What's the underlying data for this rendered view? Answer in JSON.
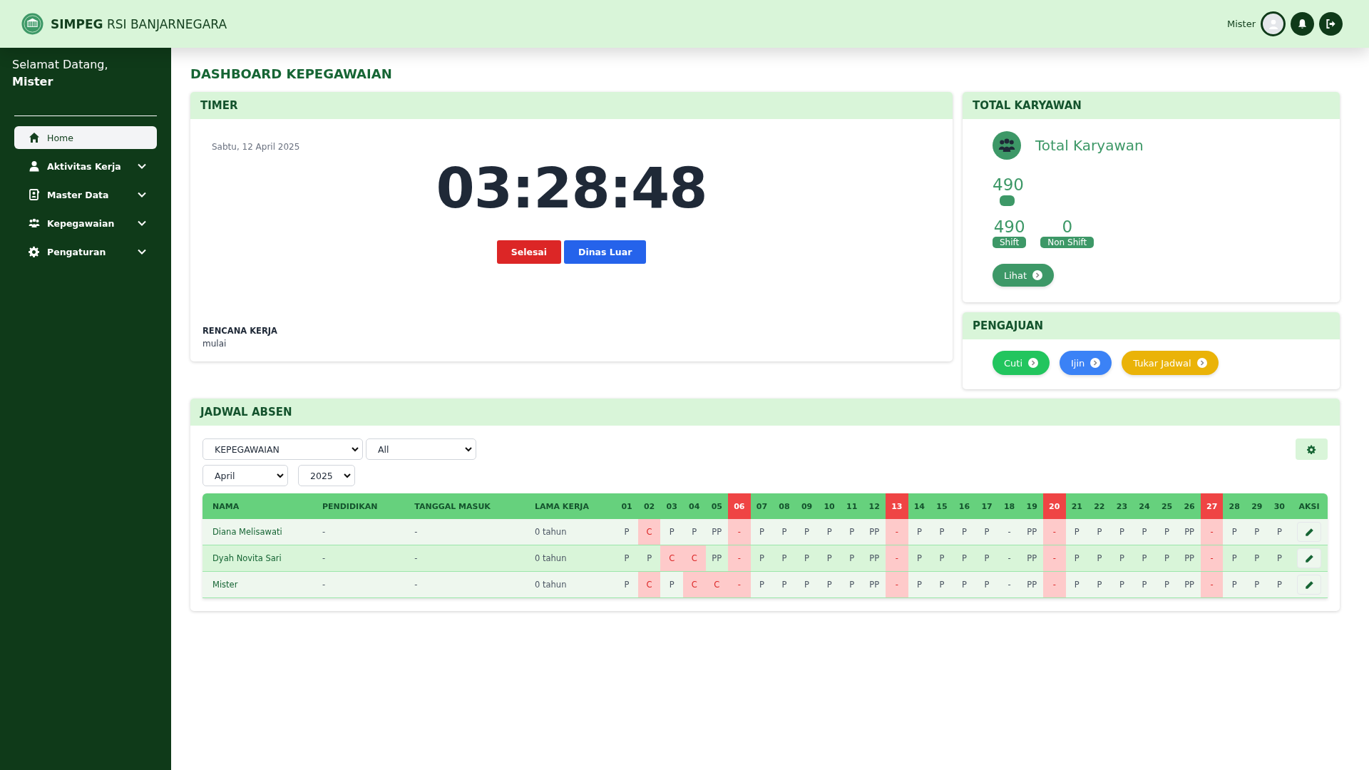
{
  "header": {
    "app_name_bold": "SIMPEG",
    "app_name_rest": "RSI BANJARNEGARA",
    "user_name": "Mister"
  },
  "sidebar": {
    "greeting": "Selamat Datang,",
    "user": "Mister",
    "items": [
      {
        "label": "Home",
        "selected": true,
        "expandable": false
      },
      {
        "label": "Aktivitas Kerja",
        "selected": false,
        "expandable": true
      },
      {
        "label": "Master Data",
        "selected": false,
        "expandable": true
      },
      {
        "label": "Kepegawaian",
        "selected": false,
        "expandable": true
      },
      {
        "label": "Pengaturan",
        "selected": false,
        "expandable": true
      }
    ]
  },
  "page_title": "DASHBOARD KEPEGAWAIAN",
  "timer": {
    "title": "TIMER",
    "date": "Sabtu, 12 April 2025",
    "time": "03:28:48",
    "buttons": [
      {
        "label": "Selesai",
        "color": "#dc2626"
      },
      {
        "label": "Dinas Luar",
        "color": "#2563eb"
      }
    ],
    "plan_label": "RENCANA KERJA",
    "plan_value": "mulai"
  },
  "total_karyawan": {
    "title": "TOTAL KARYAWAN",
    "heading": "Total Karyawan",
    "total": "490",
    "stats": [
      {
        "value": "490",
        "label": "Shift"
      },
      {
        "value": "0",
        "label": "Non Shift"
      }
    ],
    "button": "Lihat"
  },
  "pengajuan": {
    "title": "PENGAJUAN",
    "buttons": [
      {
        "label": "Cuti",
        "color": "#22c55e"
      },
      {
        "label": "Ijin",
        "color": "#3b82f6"
      },
      {
        "label": "Tukar Jadwal",
        "color": "#eab308"
      }
    ]
  },
  "jadwal": {
    "title": "JADWAL ABSEN",
    "filters": [
      "KEPEGAWAIAN",
      "All",
      "April",
      "2025"
    ],
    "columns": [
      "NAMA",
      "PENDIDIKAN",
      "TANGGAL MASUK",
      "LAMA KERJA"
    ],
    "days": [
      {
        "label": "01",
        "holiday": false
      },
      {
        "label": "02",
        "holiday": false
      },
      {
        "label": "03",
        "holiday": false
      },
      {
        "label": "04",
        "holiday": false
      },
      {
        "label": "05",
        "holiday": false
      },
      {
        "label": "06",
        "holiday": true
      },
      {
        "label": "07",
        "holiday": false
      },
      {
        "label": "08",
        "holiday": false
      },
      {
        "label": "09",
        "holiday": false
      },
      {
        "label": "10",
        "holiday": false
      },
      {
        "label": "11",
        "holiday": false
      },
      {
        "label": "12",
        "holiday": false
      },
      {
        "label": "13",
        "holiday": true
      },
      {
        "label": "14",
        "holiday": false
      },
      {
        "label": "15",
        "holiday": false
      },
      {
        "label": "16",
        "holiday": false
      },
      {
        "label": "17",
        "holiday": false
      },
      {
        "label": "18",
        "holiday": false
      },
      {
        "label": "19",
        "holiday": false
      },
      {
        "label": "20",
        "holiday": true
      },
      {
        "label": "21",
        "holiday": false
      },
      {
        "label": "22",
        "holiday": false
      },
      {
        "label": "23",
        "holiday": false
      },
      {
        "label": "24",
        "holiday": false
      },
      {
        "label": "25",
        "holiday": false
      },
      {
        "label": "26",
        "holiday": false
      },
      {
        "label": "27",
        "holiday": true
      },
      {
        "label": "28",
        "holiday": false
      },
      {
        "label": "29",
        "holiday": false
      },
      {
        "label": "30",
        "holiday": false
      }
    ],
    "action_column": "AKSI",
    "rows": [
      {
        "name": "Diana Melisawati",
        "pendidikan": "-",
        "tanggal_masuk": "-",
        "lama_kerja": "0 tahun",
        "cells": [
          {
            "text": "P",
            "kind": "plain"
          },
          {
            "text": "C",
            "kind": "marked"
          },
          {
            "text": "P",
            "kind": "plain"
          },
          {
            "text": "P",
            "kind": "plain"
          },
          {
            "text": "PP",
            "kind": "plain"
          },
          {
            "text": "-",
            "kind": "marked"
          },
          {
            "text": "P",
            "kind": "plain"
          },
          {
            "text": "P",
            "kind": "plain"
          },
          {
            "text": "P",
            "kind": "plain"
          },
          {
            "text": "P",
            "kind": "plain"
          },
          {
            "text": "P",
            "kind": "plain"
          },
          {
            "text": "PP",
            "kind": "plain"
          },
          {
            "text": "-",
            "kind": "marked"
          },
          {
            "text": "P",
            "kind": "plain"
          },
          {
            "text": "P",
            "kind": "plain"
          },
          {
            "text": "P",
            "kind": "plain"
          },
          {
            "text": "P",
            "kind": "plain"
          },
          {
            "text": "-",
            "kind": "plain"
          },
          {
            "text": "PP",
            "kind": "plain"
          },
          {
            "text": "-",
            "kind": "marked"
          },
          {
            "text": "P",
            "kind": "plain"
          },
          {
            "text": "P",
            "kind": "plain"
          },
          {
            "text": "P",
            "kind": "plain"
          },
          {
            "text": "P",
            "kind": "plain"
          },
          {
            "text": "P",
            "kind": "plain"
          },
          {
            "text": "PP",
            "kind": "plain"
          },
          {
            "text": "-",
            "kind": "marked"
          },
          {
            "text": "P",
            "kind": "plain"
          },
          {
            "text": "P",
            "kind": "plain"
          },
          {
            "text": "P",
            "kind": "plain"
          }
        ]
      },
      {
        "name": "Dyah Novita Sari",
        "pendidikan": "-",
        "tanggal_masuk": "-",
        "lama_kerja": "0 tahun",
        "cells": [
          {
            "text": "P",
            "kind": "plain"
          },
          {
            "text": "P",
            "kind": "plain"
          },
          {
            "text": "C",
            "kind": "marked"
          },
          {
            "text": "C",
            "kind": "marked"
          },
          {
            "text": "PP",
            "kind": "plain"
          },
          {
            "text": "-",
            "kind": "marked"
          },
          {
            "text": "P",
            "kind": "plain"
          },
          {
            "text": "P",
            "kind": "plain"
          },
          {
            "text": "P",
            "kind": "plain"
          },
          {
            "text": "P",
            "kind": "plain"
          },
          {
            "text": "P",
            "kind": "plain"
          },
          {
            "text": "PP",
            "kind": "plain"
          },
          {
            "text": "-",
            "kind": "marked"
          },
          {
            "text": "P",
            "kind": "plain"
          },
          {
            "text": "P",
            "kind": "plain"
          },
          {
            "text": "P",
            "kind": "plain"
          },
          {
            "text": "P",
            "kind": "plain"
          },
          {
            "text": "-",
            "kind": "plain"
          },
          {
            "text": "PP",
            "kind": "plain"
          },
          {
            "text": "-",
            "kind": "marked"
          },
          {
            "text": "P",
            "kind": "plain"
          },
          {
            "text": "P",
            "kind": "plain"
          },
          {
            "text": "P",
            "kind": "plain"
          },
          {
            "text": "P",
            "kind": "plain"
          },
          {
            "text": "P",
            "kind": "plain"
          },
          {
            "text": "PP",
            "kind": "plain"
          },
          {
            "text": "-",
            "kind": "marked"
          },
          {
            "text": "P",
            "kind": "plain"
          },
          {
            "text": "P",
            "kind": "plain"
          },
          {
            "text": "P",
            "kind": "plain"
          }
        ]
      },
      {
        "name": "Mister",
        "pendidikan": "-",
        "tanggal_masuk": "-",
        "lama_kerja": "0 tahun",
        "cells": [
          {
            "text": "P",
            "kind": "plain"
          },
          {
            "text": "C",
            "kind": "marked"
          },
          {
            "text": "P",
            "kind": "plain"
          },
          {
            "text": "C",
            "kind": "marked"
          },
          {
            "text": "C",
            "kind": "marked"
          },
          {
            "text": "-",
            "kind": "marked"
          },
          {
            "text": "P",
            "kind": "plain"
          },
          {
            "text": "P",
            "kind": "plain"
          },
          {
            "text": "P",
            "kind": "plain"
          },
          {
            "text": "P",
            "kind": "plain"
          },
          {
            "text": "P",
            "kind": "plain"
          },
          {
            "text": "PP",
            "kind": "plain"
          },
          {
            "text": "-",
            "kind": "marked"
          },
          {
            "text": "P",
            "kind": "plain"
          },
          {
            "text": "P",
            "kind": "plain"
          },
          {
            "text": "P",
            "kind": "plain"
          },
          {
            "text": "P",
            "kind": "plain"
          },
          {
            "text": "-",
            "kind": "plain"
          },
          {
            "text": "PP",
            "kind": "plain"
          },
          {
            "text": "-",
            "kind": "marked"
          },
          {
            "text": "P",
            "kind": "plain"
          },
          {
            "text": "P",
            "kind": "plain"
          },
          {
            "text": "P",
            "kind": "plain"
          },
          {
            "text": "P",
            "kind": "plain"
          },
          {
            "text": "P",
            "kind": "plain"
          },
          {
            "text": "PP",
            "kind": "plain"
          },
          {
            "text": "-",
            "kind": "marked"
          },
          {
            "text": "P",
            "kind": "plain"
          },
          {
            "text": "P",
            "kind": "plain"
          },
          {
            "text": "P",
            "kind": "plain"
          }
        ]
      }
    ]
  }
}
